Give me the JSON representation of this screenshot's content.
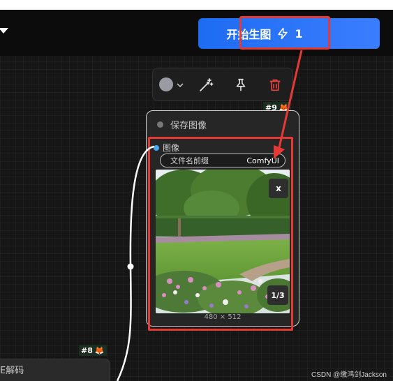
{
  "topbar": {
    "run_button_label": "开始生图",
    "queue_count": "1"
  },
  "toolbar": {
    "color_swatch": "#9a9aa2",
    "tools": [
      "color-picker-icon",
      "chevron-down-icon",
      "wand-icon",
      "pin-icon",
      "trash-icon"
    ]
  },
  "save_node": {
    "id": "#9",
    "title": "保存图像",
    "input_label": "图像",
    "prefix_label": "文件名前缀",
    "prefix_value": "ComfyUI",
    "close_label": "x",
    "page_counter": "1/3",
    "image_size": "480 × 512"
  },
  "decode_node": {
    "id": "#8",
    "title": "E解码"
  },
  "watermark": "CSDN @缴鸿剑Jackson",
  "colors": {
    "accent": "#1d6cf2",
    "highlight": "#e53935",
    "socket": "#4aa3f0"
  }
}
